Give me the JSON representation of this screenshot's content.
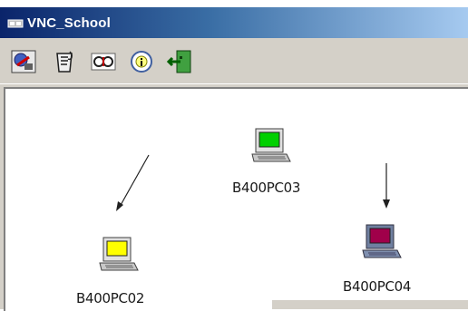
{
  "window": {
    "title": "VNC_School",
    "title_icon": "network-app-icon"
  },
  "toolbar": {
    "buttons": [
      {
        "name": "connect-button",
        "icon": "connect-icon"
      },
      {
        "name": "properties-button",
        "icon": "clipboard-icon"
      },
      {
        "name": "view-button",
        "icon": "view-icon"
      },
      {
        "name": "info-button",
        "icon": "info-icon"
      },
      {
        "name": "exit-button",
        "icon": "exit-door-icon"
      }
    ]
  },
  "computers": [
    {
      "label": "B400PC02",
      "screen_color": "#ffff00"
    },
    {
      "label": "B400PC03",
      "screen_color": "#00d000"
    },
    {
      "label": "B400PC04",
      "screen_color": "#a0004a"
    }
  ],
  "colors": {
    "titlebar_start": "#0a246a",
    "titlebar_end": "#a6caf0",
    "face": "#d4d0c8"
  }
}
